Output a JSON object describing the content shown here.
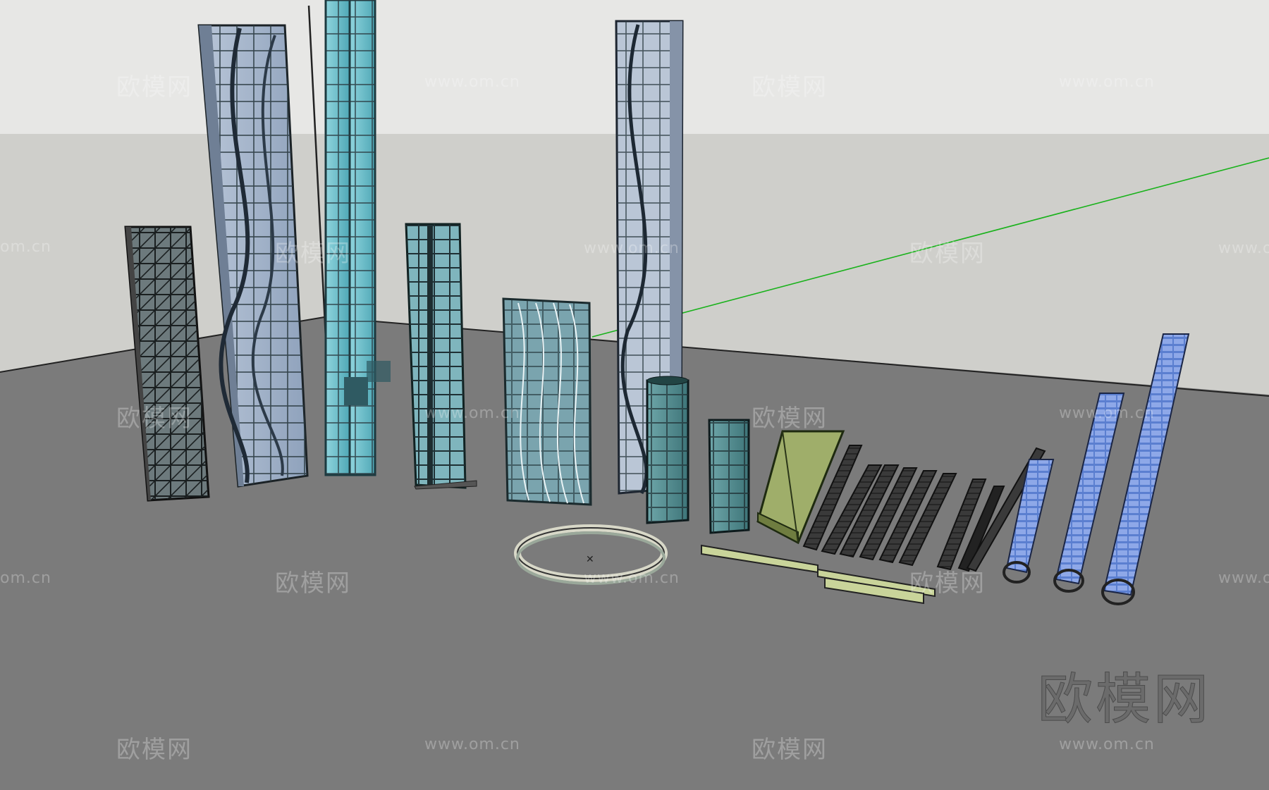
{
  "scene": {
    "description_free": true,
    "sky_color": "#e6e6e4",
    "wall_color": "#cfcfcc",
    "ground_color": "#7c7c7c",
    "axis_green": "#19b21b"
  },
  "watermarks": {
    "brand_cn": "欧模网",
    "url": "www.om.cn",
    "url_clipped": "om.cn",
    "url_clipped_right": "www.o"
  },
  "logo_big": "欧模网"
}
